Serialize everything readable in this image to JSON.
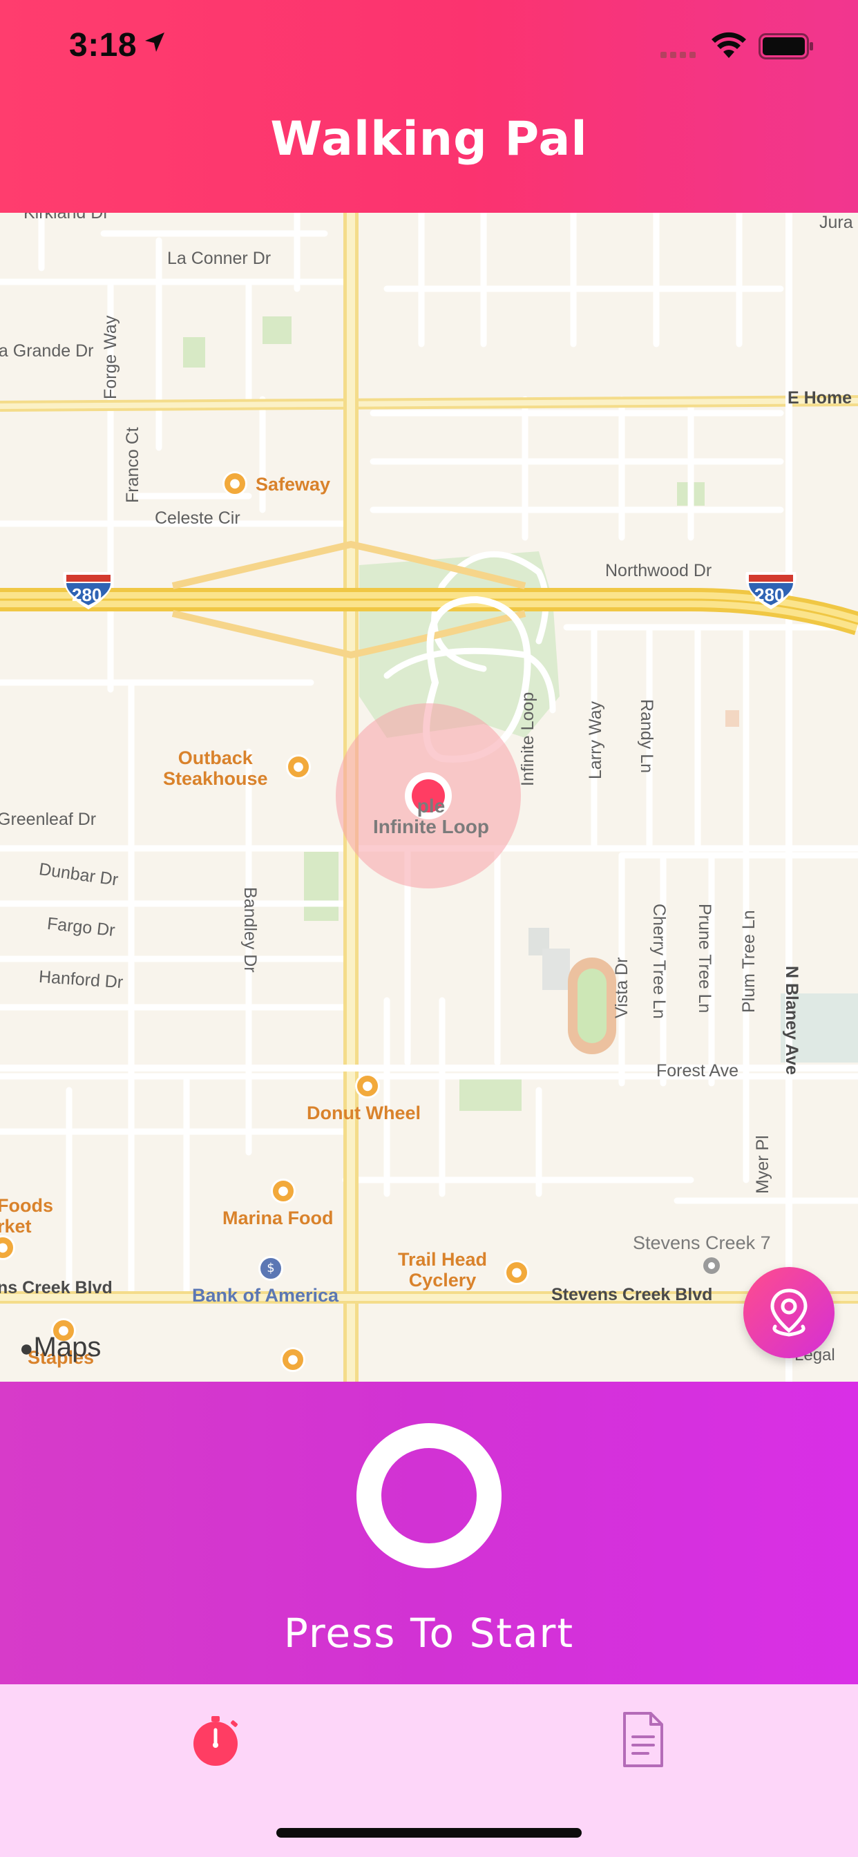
{
  "status_bar": {
    "time": "3:18"
  },
  "header": {
    "title": "Walking Pal"
  },
  "map": {
    "streets": {
      "kirkland": "Kirkland Dr",
      "la_conner": "La Conner Dr",
      "la_grande": "La Grande Dr",
      "forge_way": "Forge Way",
      "franco_ct": "Franco Ct",
      "celeste_cir": "Celeste Cir",
      "e_home": "E Home",
      "jura": "Jura",
      "northwood": "Northwood Dr",
      "infinite_loop_st": "Infinite Loop",
      "larry_way": "Larry Way",
      "randy_ln": "Randy Ln",
      "greenleaf": "Greenleaf Dr",
      "dunbar": "Dunbar Dr",
      "fargo": "Fargo Dr",
      "hanford": "Hanford Dr",
      "bandley": "Bandley Dr",
      "vista": "Vista Dr",
      "cherry_tree": "Cherry Tree Ln",
      "prune_tree": "Prune Tree Ln",
      "plum_tree": "Plum Tree Ln",
      "n_blaney": "N Blaney Ave",
      "forest_ave": "Forest Ave",
      "myer_pl": "Myer Pl",
      "stevens_creek_left": "ns Creek Blvd",
      "stevens_creek_right": "Stevens Creek Blvd",
      "highway_shield": "280"
    },
    "pois": {
      "safeway": "Safeway",
      "outback": "Outback\nSteakhouse",
      "infinite_loop": "ple\nInfinite Loop",
      "donut_wheel": "Donut Wheel",
      "foods_market": "Foods\nrket",
      "marina_food": "Marina Food",
      "trail_head": "Trail Head\nCyclery",
      "bank_of_america": "Bank of America",
      "stevens_creek_7": "Stevens Creek 7",
      "staples": "Staples"
    },
    "watermark": "Maps",
    "legal": "Legal"
  },
  "control": {
    "start_label": "Press To Start"
  },
  "tabs": [
    {
      "icon": "stopwatch-icon",
      "active": true,
      "color": "#ff3d63"
    },
    {
      "icon": "document-icon",
      "active": false,
      "color": "#b46bb8"
    }
  ],
  "colors": {
    "header_accent": "#ff3d6e",
    "control_accent": "#d232d4",
    "user_location": "#ff3d63",
    "tabbar_bg": "#fdd6f9"
  }
}
